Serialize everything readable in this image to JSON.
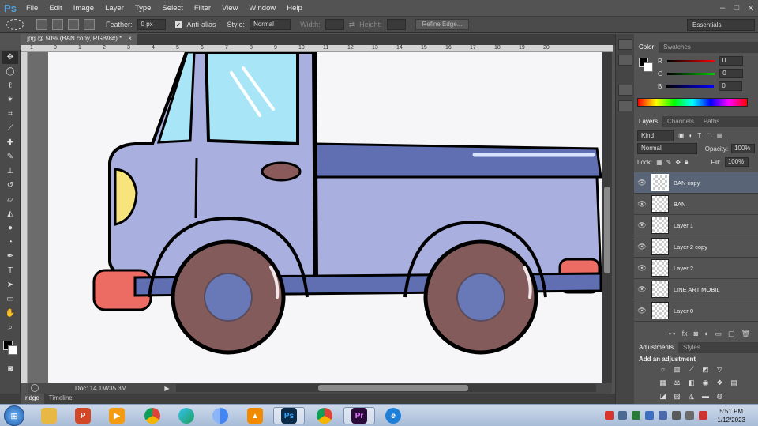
{
  "app": {
    "logo": "Ps",
    "menu": [
      "File",
      "Edit",
      "Image",
      "Layer",
      "Type",
      "Select",
      "Filter",
      "View",
      "Window",
      "Help"
    ],
    "window_controls": [
      "–",
      "□",
      "✕"
    ]
  },
  "options": {
    "feather_label": "Feather:",
    "feather_value": "0 px",
    "antialias_label": "Anti-alias",
    "style_label": "Style:",
    "style_value": "Normal",
    "width_label": "Width:",
    "height_label": "Height:",
    "refine_label": "Refine Edge...",
    "workspace": "Essentials"
  },
  "document": {
    "tab_title": ".jpg @ 50% (BAN copy, RGB/8#) *",
    "ruler_ticks": [
      "1",
      "0",
      "1",
      "2",
      "3",
      "4",
      "5",
      "6",
      "7",
      "8",
      "9",
      "10",
      "11",
      "12",
      "13",
      "14",
      "15",
      "16",
      "17",
      "18",
      "19",
      "20"
    ],
    "status_zoom": "",
    "status_doc": "Doc: 14.1M/35.3M"
  },
  "bottom_tabs": [
    "ridge",
    "Timeline"
  ],
  "color_panel": {
    "tabs": [
      "Color",
      "Swatches"
    ],
    "channels": [
      {
        "label": "R",
        "value": "0",
        "gradient": "linear-gradient(90deg,#000,#f00)"
      },
      {
        "label": "G",
        "value": "0",
        "gradient": "linear-gradient(90deg,#000,#0c0)"
      },
      {
        "label": "B",
        "value": "0",
        "gradient": "linear-gradient(90deg,#000,#00f)"
      }
    ]
  },
  "layers_panel": {
    "tabs": [
      "Layers",
      "Channels",
      "Paths"
    ],
    "kind": "Kind",
    "blend_mode": "Normal",
    "opacity_label": "Opacity:",
    "opacity_value": "100%",
    "lock_label": "Lock:",
    "fill_label": "Fill:",
    "fill_value": "100%",
    "layers": [
      {
        "name": "BAN copy",
        "selected": true
      },
      {
        "name": "BAN",
        "selected": false
      },
      {
        "name": "Layer 1",
        "selected": false
      },
      {
        "name": "Layer 2 copy",
        "selected": false
      },
      {
        "name": "Layer 2",
        "selected": false
      },
      {
        "name": "LINE ART MOBIL",
        "selected": false
      },
      {
        "name": "Layer 0",
        "selected": false
      }
    ]
  },
  "adjustments_panel": {
    "tabs": [
      "Adjustments",
      "Styles"
    ],
    "heading": "Add an adjustment"
  },
  "taskbar": {
    "clock_time": "5:51 PM",
    "clock_date": "1/12/2023",
    "apps": [
      {
        "name": "explorer",
        "label": "",
        "color": "#e7b844"
      },
      {
        "name": "powerpoint",
        "label": "P",
        "color": "#d24726"
      },
      {
        "name": "media-player",
        "label": "▶",
        "color": "#f39c12"
      },
      {
        "name": "chrome",
        "label": "",
        "color": "#4285f4"
      },
      {
        "name": "edge",
        "label": "",
        "color": "#1fa0b8"
      },
      {
        "name": "chrome-2",
        "label": "",
        "color": "#4285f4"
      },
      {
        "name": "vlc",
        "label": "▲",
        "color": "#f08a00"
      },
      {
        "name": "photoshop",
        "label": "Ps",
        "color": "#0c2b48"
      },
      {
        "name": "chrome-3",
        "label": "",
        "color": "#db4437"
      },
      {
        "name": "premiere",
        "label": "Pr",
        "color": "#2a0a3a"
      },
      {
        "name": "internet-explorer",
        "label": "e",
        "color": "#1e7fd8"
      }
    ]
  }
}
